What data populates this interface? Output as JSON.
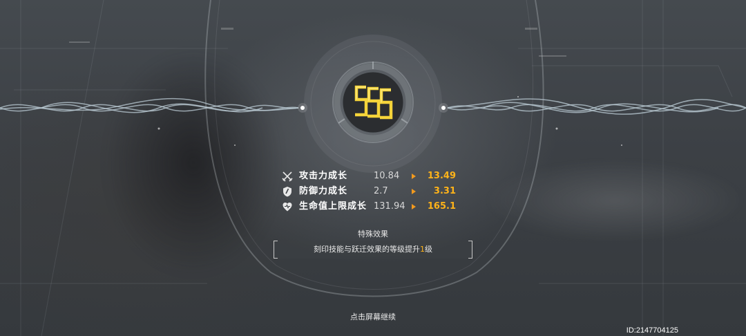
{
  "emblem": {
    "icon": "sss-rank-icon",
    "color": "#f5d43a"
  },
  "stats": [
    {
      "icon": "attack-icon",
      "label": "攻击力成长",
      "old": "10.84",
      "new": "13.49"
    },
    {
      "icon": "defense-icon",
      "label": "防御力成长",
      "old": "2.7",
      "new": "3.31"
    },
    {
      "icon": "hp-icon",
      "label": "生命值上限成长",
      "old": "131.94",
      "new": "165.1"
    }
  ],
  "special": {
    "title": "特殊效果",
    "text_prefix": "刻印技能与跃迁效果的等级提升",
    "highlight": "1",
    "text_suffix": "级"
  },
  "continue_hint": "点击屏幕继续",
  "user_id": "ID:2147704125",
  "colors": {
    "highlight": "#ffb319",
    "arrow": "#f29a1e",
    "text": "#ffffff"
  }
}
